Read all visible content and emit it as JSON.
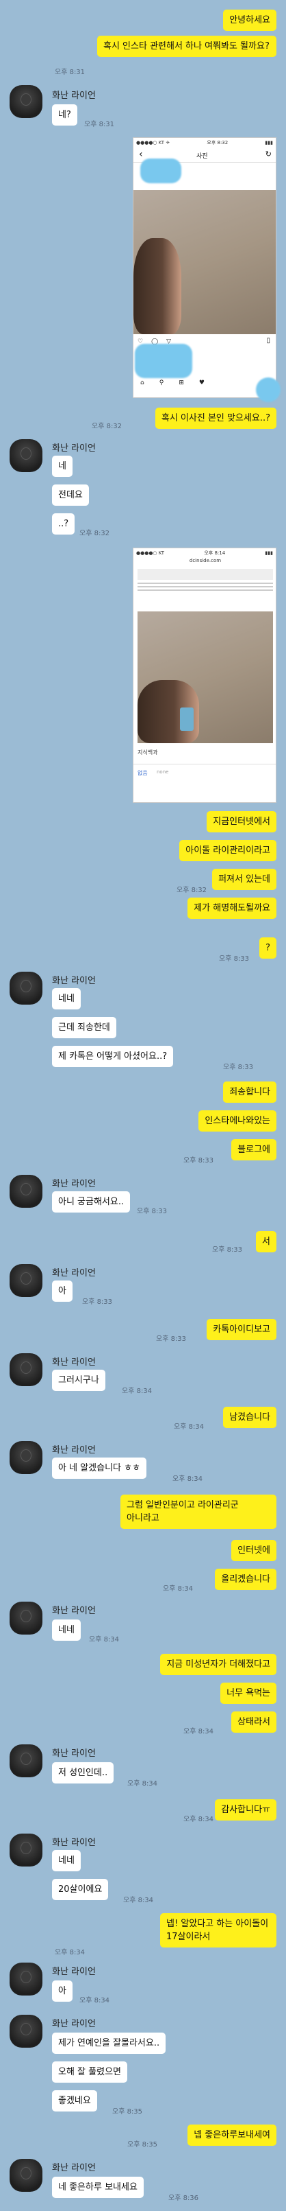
{
  "contact_name": "화난 라이언",
  "messages": [
    {
      "from": "me",
      "text": "안녕하세요",
      "time": ""
    },
    {
      "from": "me",
      "text": "혹시 인스타 관련해서 하나 여쭤봐도 될까요?",
      "time": "오후 8:31"
    },
    {
      "from": "them",
      "text": "네?",
      "time": "오후 8:31"
    },
    {
      "from": "me",
      "text": "혹시 이사진 본인 맞으세요..?",
      "time": "오후 8:32"
    },
    {
      "from": "them",
      "text": "네",
      "time": ""
    },
    {
      "from": "them",
      "text": "전데요",
      "time": ""
    },
    {
      "from": "them",
      "text": "..?",
      "time": "오후 8:32"
    },
    {
      "from": "me",
      "text": "지금인터넷에서",
      "time": ""
    },
    {
      "from": "me",
      "text": "아이돌 라이관리이라고",
      "time": ""
    },
    {
      "from": "me",
      "text": "퍼져서 있는데",
      "time": "오후 8:32"
    },
    {
      "from": "me",
      "text": "제가 해명해도될까요",
      "time": ""
    },
    {
      "from": "me",
      "text": "?",
      "time": "오후 8:33"
    },
    {
      "from": "them",
      "text": "네네",
      "time": ""
    },
    {
      "from": "them",
      "text": "근데 죄송한데",
      "time": ""
    },
    {
      "from": "them",
      "text": "제 카톡은 어떻게 아셨어요..?",
      "time": "오후 8:33"
    },
    {
      "from": "me",
      "text": "죄송합니다",
      "time": ""
    },
    {
      "from": "me",
      "text": "인스타에나와있는",
      "time": ""
    },
    {
      "from": "me",
      "text": "블로그에",
      "time": "오후 8:33"
    },
    {
      "from": "them",
      "text": "아니 궁금해서요..",
      "time": "오후 8:33"
    },
    {
      "from": "me",
      "text": "서",
      "time": "오후 8:33"
    },
    {
      "from": "them",
      "text": "아",
      "time": "오후 8:33"
    },
    {
      "from": "me",
      "text": "카톡아이디보고",
      "time": "오후 8:33"
    },
    {
      "from": "them",
      "text": "그러시구나",
      "time": "오후 8:34"
    },
    {
      "from": "me",
      "text": "남겼습니다",
      "time": "오후 8:34"
    },
    {
      "from": "them",
      "text": "아 네 알겠습니다 ㅎㅎ",
      "time": "오후 8:34"
    },
    {
      "from": "me",
      "text": "그럼 일반인분이고 라이관리군 아니라고",
      "time": ""
    },
    {
      "from": "me",
      "text": "인터넷에",
      "time": ""
    },
    {
      "from": "me",
      "text": "올리겠습니다",
      "time": "오후 8:34"
    },
    {
      "from": "them",
      "text": "네네",
      "time": "오후 8:34"
    },
    {
      "from": "me",
      "text": "지금 미성년자가 더해졌다고",
      "time": ""
    },
    {
      "from": "me",
      "text": "너무 욕먹는",
      "time": ""
    },
    {
      "from": "me",
      "text": "상태라서",
      "time": "오후 8:34"
    },
    {
      "from": "them",
      "text": "저 성인인데..",
      "time": "오후 8:34"
    },
    {
      "from": "me",
      "text": "감사합니다ㅠ",
      "time": "오후 8:34"
    },
    {
      "from": "them",
      "text": "네네",
      "time": ""
    },
    {
      "from": "them",
      "text": "20살이에요",
      "time": "오후 8:34"
    },
    {
      "from": "me",
      "text": "넵! 알았다고 하는 아이돌이 17살이라서",
      "time": "오후 8:34"
    },
    {
      "from": "them",
      "text": "아",
      "time": "오후 8:34"
    },
    {
      "from": "them",
      "text": "제가 연예인을 잘몰라서요..",
      "time": ""
    },
    {
      "from": "them",
      "text": "오해 잘 풀렸으면",
      "time": ""
    },
    {
      "from": "them",
      "text": "좋겠네요",
      "time": "오후 8:35"
    },
    {
      "from": "me",
      "text": "넵 좋은하루보내세여",
      "time": "오후 8:35"
    },
    {
      "from": "them",
      "text": "네 좋은하루 보내세요",
      "time": "오후 8:36"
    }
  ],
  "screenshot1": {
    "status_time": "오후 8:32",
    "title": "사진"
  },
  "screenshot2": {
    "status_time": "오후 8:14",
    "url": "dcinside.com",
    "caption": "지식백과",
    "footer_label": "없음",
    "footer_value": "none"
  }
}
